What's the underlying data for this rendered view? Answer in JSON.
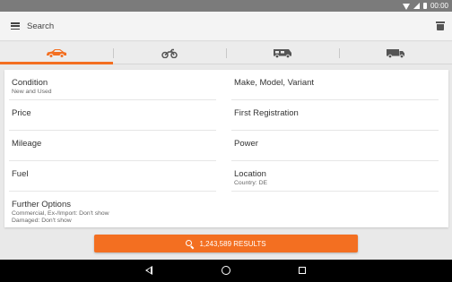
{
  "statusbar": {
    "time": "00:00"
  },
  "toolbar": {
    "search_label": "Search"
  },
  "tabs": [
    {
      "name": "car",
      "active": true
    },
    {
      "name": "motorcycle",
      "active": false
    },
    {
      "name": "motorhome",
      "active": false
    },
    {
      "name": "truck",
      "active": false
    }
  ],
  "colors": {
    "accent": "#f36f21",
    "statusbar": "#7b7b7b",
    "toolbar": "#f4f4f4"
  },
  "filters": {
    "condition": {
      "title": "Condition",
      "value": "New and Used"
    },
    "make_model": {
      "title": "Make, Model, Variant"
    },
    "price": {
      "title": "Price"
    },
    "first_registration": {
      "title": "First Registration"
    },
    "mileage": {
      "title": "Mileage"
    },
    "power": {
      "title": "Power"
    },
    "fuel": {
      "title": "Fuel"
    },
    "location": {
      "title": "Location",
      "value": "Country: DE"
    },
    "further_options": {
      "title": "Further Options",
      "value1": "Commercial, Ex-/Import: Don't show",
      "value2": "Damaged: Don't show"
    }
  },
  "results_button": {
    "label": "1,243,589 RESULTS"
  }
}
